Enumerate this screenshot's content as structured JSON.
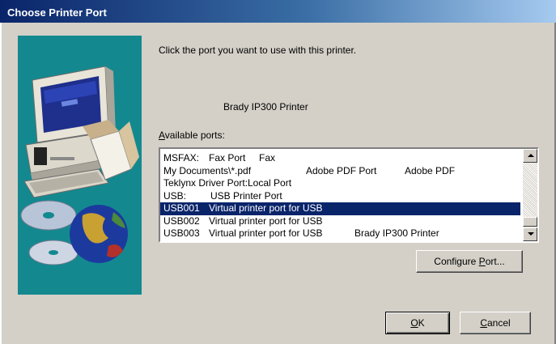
{
  "window": {
    "title": "Choose Printer Port"
  },
  "dialog": {
    "instruction": "Click the port you want to use with this printer.",
    "printer_name": "Brady IP300 Printer",
    "ports_label_mnemonic": "A",
    "ports_label_rest": "vailable ports:"
  },
  "ports": [
    {
      "col1": "MSFAX:",
      "col2": "Fax Port",
      "col3": "Fax",
      "selected": false
    },
    {
      "col1": "My Documents\\*.pdf",
      "col2": "Adobe PDF Port",
      "col3": "Adobe PDF",
      "selected": false
    },
    {
      "col1": "Teklynx Driver Port:",
      "col2": "Local Port",
      "col3": "",
      "selected": false
    },
    {
      "col1": "USB:",
      "col2": "USB Printer Port",
      "col3": "",
      "selected": false
    },
    {
      "col1": "USB001",
      "col2": "Virtual printer port for USB",
      "col3": "",
      "selected": true
    },
    {
      "col1": "USB002",
      "col2": "Virtual printer port for USB",
      "col3": "",
      "selected": false
    },
    {
      "col1": "USB003",
      "col2": "Virtual printer port for USB",
      "col3": "Brady IP300 Printer",
      "selected": false
    }
  ],
  "buttons": {
    "configure_before": "Configure ",
    "configure_mnemonic": "P",
    "configure_after": "ort...",
    "ok_mnemonic": "O",
    "ok_rest": "K",
    "cancel_mnemonic": "C",
    "cancel_rest": "ancel"
  },
  "icons": {
    "illustration": "computer-with-cds-and-globe-illustration",
    "scroll_up": "scroll-up-arrow-icon",
    "scroll_down": "scroll-down-arrow-icon"
  },
  "colors": {
    "title_gradient_start": "#0a246a",
    "title_gradient_end": "#a6caf0",
    "dialog_bg": "#d4d0c8",
    "illustration_bg": "#13898f",
    "selection_bg": "#0a246a"
  }
}
